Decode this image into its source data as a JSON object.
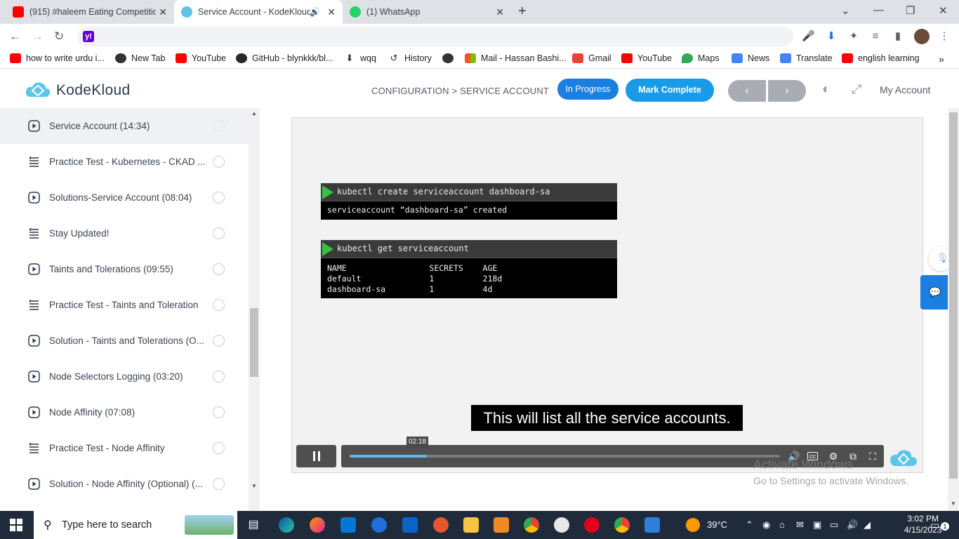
{
  "browser": {
    "tabs": [
      {
        "title": "(915) #haleem Eating Competitio",
        "favicon": "youtube-icon"
      },
      {
        "title": "Service Account - KodeKloud",
        "favicon": "kodekloud-icon"
      },
      {
        "title": "(1) WhatsApp",
        "favicon": "whatsapp-icon"
      }
    ],
    "url": "",
    "bookmarks": [
      {
        "label": "how to write urdu i...",
        "icon": "youtube-icon"
      },
      {
        "label": "New Tab",
        "icon": "globe-icon"
      },
      {
        "label": "YouTube",
        "icon": "youtube-icon"
      },
      {
        "label": "GitHub - blynkkk/bl...",
        "icon": "github-icon"
      },
      {
        "label": "wqq",
        "icon": "download-icon"
      },
      {
        "label": "History",
        "icon": "history-icon"
      },
      {
        "label": "",
        "icon": "globe-icon"
      },
      {
        "label": "Mail - Hassan Bashi...",
        "icon": "microsoft-icon"
      },
      {
        "label": "Gmail",
        "icon": "gmail-icon"
      },
      {
        "label": "YouTube",
        "icon": "youtube-icon"
      },
      {
        "label": "Maps",
        "icon": "maps-icon"
      },
      {
        "label": "News",
        "icon": "news-icon"
      },
      {
        "label": "Translate",
        "icon": "translate-icon"
      },
      {
        "label": "english learning",
        "icon": "youtube-icon"
      }
    ]
  },
  "app": {
    "logo_text": "KodeKloud",
    "breadcrumb": "CONFIGURATION > SERVICE ACCOUNT",
    "status_label": "In Progress",
    "complete_label": "Mark Complete",
    "prev_label": "‹",
    "next_label": "›",
    "account_label": "My Account",
    "brand_color": "#1a7fe0"
  },
  "sidebar": {
    "items": [
      {
        "label": "Service Account (14:34)",
        "type": "video",
        "active": true
      },
      {
        "label": "Practice Test - Kubernetes - CKAD ...",
        "type": "lab"
      },
      {
        "label": "Solutions-Service Account (08:04)",
        "type": "video"
      },
      {
        "label": "Stay Updated!",
        "type": "lab"
      },
      {
        "label": "Taints and Tolerations (09:55)",
        "type": "video"
      },
      {
        "label": "Practice Test - Taints and Toleration",
        "type": "lab"
      },
      {
        "label": "Solution - Taints and Tolerations (O...",
        "type": "video"
      },
      {
        "label": "Node Selectors Logging (03:20)",
        "type": "video"
      },
      {
        "label": "Node Affinity (07:08)",
        "type": "video"
      },
      {
        "label": "Practice Test - Node Affinity",
        "type": "lab"
      },
      {
        "label": "Solution - Node Affinity (Optional) (...",
        "type": "video"
      }
    ]
  },
  "video": {
    "term1": {
      "command": "kubectl create serviceaccount dashboard-sa",
      "output": "serviceaccount “dashboard-sa” created"
    },
    "term2": {
      "command": "kubectl get serviceaccount",
      "header": "NAME                 SECRETS    AGE",
      "row1": "default              1          218d",
      "row2": "dashboard-sa         1          4d"
    },
    "caption": "This will list all the service accounts.",
    "current_time": "02:18",
    "progress_fraction": 0.18,
    "watermark_title": "Activate Windows",
    "watermark_sub": "Go to Settings to activate Windows."
  },
  "taskbar": {
    "search_placeholder": "Type here to search",
    "weather": "39°C",
    "time": "3:02 PM",
    "date": "4/15/2023",
    "notifications": "1"
  }
}
